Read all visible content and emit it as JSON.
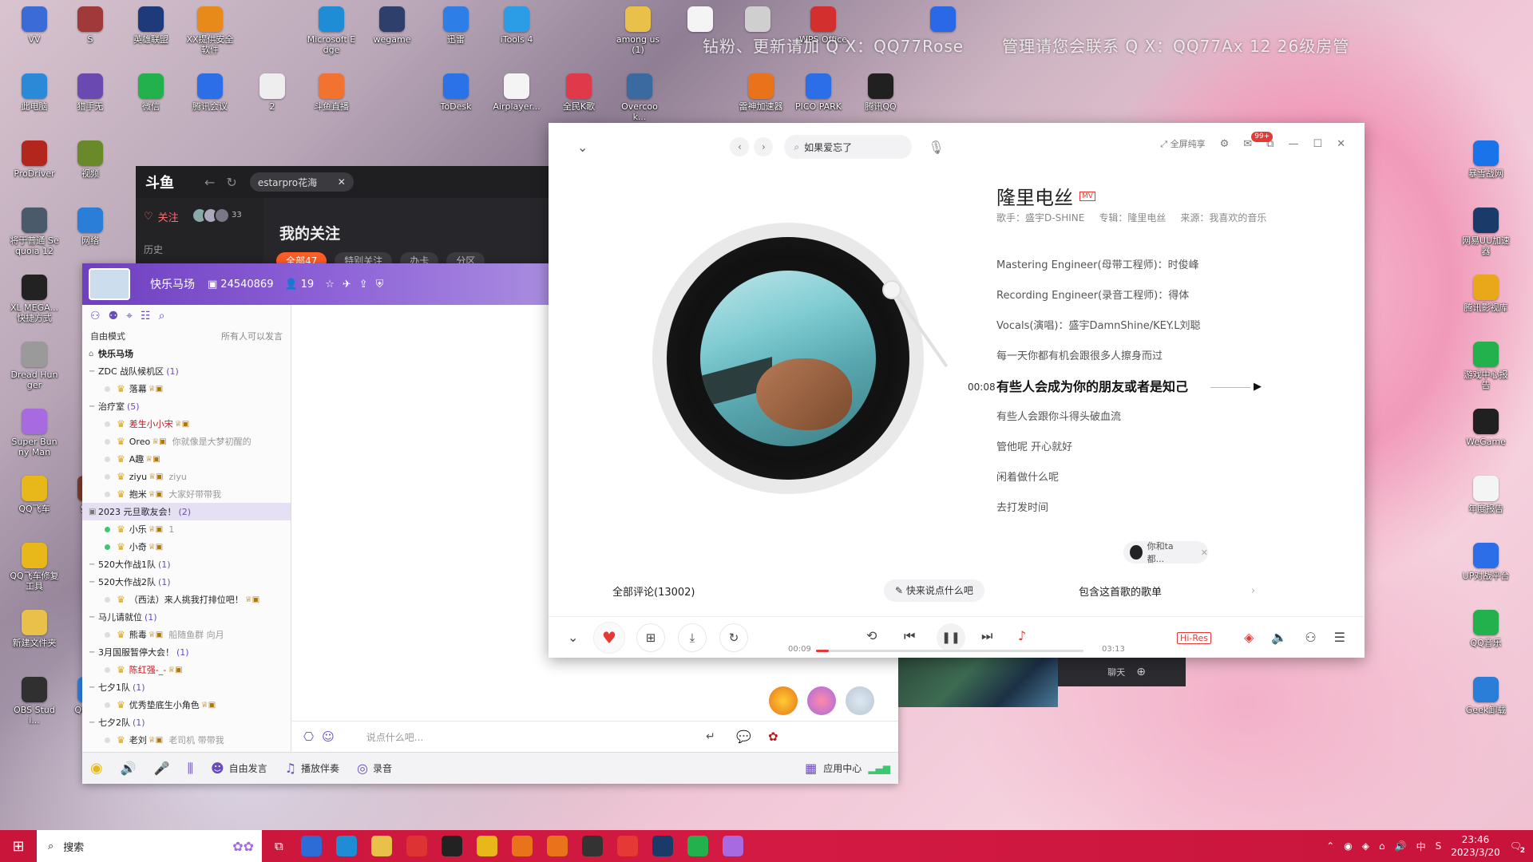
{
  "desktop": {
    "overlay_lines": [
      "钻粉、更新请加 Q X：QQ77Rose",
      "管理请您会联系 Q X：QQ77Ax   12 26级房管"
    ],
    "icons": [
      {
        "label": "VV",
        "color": "#3b6bd6"
      },
      {
        "label": "S",
        "color": "#a03a3a"
      },
      {
        "label": "英雄联盟",
        "color": "#1f3a7a"
      },
      {
        "label": "XX提供安全软件",
        "color": "#e88a1a"
      },
      {
        "label": "Microsoft Edge",
        "color": "#1f8cd6"
      },
      {
        "label": "wegame",
        "color": "#2d3f6a"
      },
      {
        "label": "迅雷",
        "color": "#2d7ee6"
      },
      {
        "label": "iTools 4",
        "color": "#2a9de6"
      },
      {
        "label": "among us(1)",
        "color": "#e8c04a"
      },
      {
        "label": "",
        "color": "#f4f4f4"
      },
      {
        "label": "",
        "color": "#cfcfcf"
      },
      {
        "label": "WPS Office",
        "color": "#d32f2f"
      },
      {
        "label": "",
        "color": "#2b68e8"
      },
      {
        "label": "此电脑",
        "color": "#2b8ad8"
      },
      {
        "label": "猎手无",
        "color": "#6a4ab0"
      },
      {
        "label": "微信",
        "color": "#23b14d"
      },
      {
        "label": "腾讯会议",
        "color": "#2b6ee8"
      },
      {
        "label": "2",
        "color": "#eeeeee"
      },
      {
        "label": "斗鱼直播",
        "color": "#f27330"
      },
      {
        "label": "ToDesk",
        "color": "#2a72e8"
      },
      {
        "label": "Airplayer...",
        "color": "#f4f4f4"
      },
      {
        "label": "全民K歌",
        "color": "#e03a4a"
      },
      {
        "label": "Overcook...",
        "color": "#3a6aa0"
      },
      {
        "label": "雷神加速器",
        "color": "#e8731a"
      },
      {
        "label": "PICO PARK",
        "color": "#2b6ee8"
      },
      {
        "label": "腾讯QQ",
        "color": "#202020"
      },
      {
        "label": "ProDriver",
        "color": "#b3261e"
      },
      {
        "label": "视频",
        "color": "#6a8a2a"
      },
      {
        "label": "将于普通 Sequoia 12",
        "color": "#4a5a6a"
      },
      {
        "label": "网络",
        "color": "#2b7ed8"
      },
      {
        "label": "XL MEGA...快捷方式",
        "color": "#222222"
      },
      {
        "label": "Dread Hunger",
        "color": "#9a9a9a"
      },
      {
        "label": "Super Bunny Man",
        "color": "#a76ae0"
      },
      {
        "label": "QQ飞车",
        "color": "#e8b81a"
      },
      {
        "label": "Som",
        "color": "#7a3a2a"
      },
      {
        "label": "QQ飞车修复工具",
        "color": "#e8b81a"
      },
      {
        "label": "新建文件夹",
        "color": "#e8c04a"
      },
      {
        "label": "OBS Studi...",
        "color": "#303030"
      },
      {
        "label": "QQ浏览",
        "color": "#2b7ee8"
      },
      {
        "label": "暴雪战网",
        "color": "#1a73e8"
      },
      {
        "label": "网易UU加速器",
        "color": "#1a3a6a"
      },
      {
        "label": "腾讯影视库",
        "color": "#e8a81a"
      },
      {
        "label": "游戏中心报告",
        "color": "#23b14d"
      },
      {
        "label": "WeGame",
        "color": "#202020"
      },
      {
        "label": "年度报告",
        "color": "#f4f4f4"
      },
      {
        "label": "UP对战平台",
        "color": "#2b6ee8"
      },
      {
        "label": "QQ音乐",
        "color": "#23b14d"
      },
      {
        "label": "Geek卸载",
        "color": "#2b7ed8"
      }
    ]
  },
  "douyu": {
    "logo": "斗鱼",
    "search_text": "estarpro花海",
    "follow_label": "关注",
    "avatar_count": "33",
    "history_label": "历史",
    "page_title": "我的关注",
    "tabs": [
      "全部47",
      "特别关注",
      "办卡",
      "分区"
    ]
  },
  "yy": {
    "channel_name": "快乐马场",
    "channel_id": "24540869",
    "user_count": "19",
    "mode_label": "自由模式",
    "mode_hint": "所有人可以发言",
    "tree": [
      {
        "type": "root",
        "name": "快乐马场"
      },
      {
        "type": "group",
        "name": "ZDC 战队候机区",
        "count": "(1)"
      },
      {
        "type": "user",
        "name": "落幕",
        "online": false,
        "sig": ""
      },
      {
        "type": "group",
        "name": "治疗室",
        "count": "(5)"
      },
      {
        "type": "user",
        "name": "差生小小宋",
        "online": false,
        "sig": "",
        "red": true
      },
      {
        "type": "user",
        "name": "Oreo",
        "online": false,
        "sig": "你就像是大梦初醒的"
      },
      {
        "type": "user",
        "name": "A趣",
        "online": false,
        "sig": ""
      },
      {
        "type": "user",
        "name": "ziyu",
        "online": false,
        "sig": "ziyu"
      },
      {
        "type": "user",
        "name": "抱米",
        "online": false,
        "sig": "大家好带带我"
      },
      {
        "type": "group",
        "name": "2023 元旦歌友会！",
        "count": "(2)",
        "hl": true
      },
      {
        "type": "user",
        "name": "小乐",
        "online": true,
        "sig": "1"
      },
      {
        "type": "user",
        "name": "小奇",
        "online": true,
        "sig": ""
      },
      {
        "type": "group",
        "name": "520大作战1队",
        "count": "(1)"
      },
      {
        "type": "group",
        "name": "520大作战2队",
        "count": "(1)"
      },
      {
        "type": "user",
        "name": "（西法）来人挑我打排位吧！",
        "online": false,
        "sig": ""
      },
      {
        "type": "group",
        "name": "马儿请就位",
        "count": "(1)"
      },
      {
        "type": "user",
        "name": "熊毒",
        "online": false,
        "sig": "船随鱼群  向月"
      },
      {
        "type": "group",
        "name": "3月国服暂停大会！",
        "count": "(1)"
      },
      {
        "type": "user",
        "name": "陈红强-_-",
        "online": false,
        "sig": "",
        "red": true
      },
      {
        "type": "group",
        "name": "七夕1队",
        "count": "(1)"
      },
      {
        "type": "user",
        "name": "优秀垫底生小角色",
        "online": false,
        "sig": ""
      },
      {
        "type": "group",
        "name": "七夕2队",
        "count": "(1)"
      },
      {
        "type": "user",
        "name": "老刘",
        "online": false,
        "sig": "老司机 带带我"
      }
    ],
    "input_placeholder": "说点什么吧...",
    "bottom": {
      "free_talk": "自由发言",
      "accompany": "播放伴奏",
      "record": "录音",
      "app_center": "应用中心"
    }
  },
  "music": {
    "search_text": "如果爱忘了",
    "fullscreen_label": "全屏纯享",
    "mail_badge": "99+",
    "song_title": "隆里电丝",
    "mv_badge": "MV",
    "meta": {
      "singer": "歌手：盛宇D-SHINE",
      "album": "专辑：隆里电丝",
      "source": "来源：我喜欢的音乐"
    },
    "lyrics": [
      "Mastering Engineer(母带工程师)：时俊峰",
      "Recording Engineer(录音工程师)：得体",
      "Vocals(演唱)：盛宇DamnShine/KEY.L刘聪",
      "每一天你都有机会跟很多人擦身而过",
      "有些人会成为你的朋友或者是知己",
      "有些人会跟你斗得头破血流",
      "管他呢 开心就好",
      "闲着做什么呢",
      "去打发时间"
    ],
    "current_lyric_index": 4,
    "current_time_label": "00:08",
    "comments_label": "全部评论(13002)",
    "quick_comment": "快来说点什么吧",
    "playlists_label": "包含这首歌的歌单",
    "friend_label": "你和ta都...",
    "time_start": "00:09",
    "time_end": "03:13",
    "progress": 0.047,
    "hires_label": "Hi-Res"
  },
  "gamethumb": {
    "label": "聊天"
  },
  "taskbar": {
    "search_label": "搜索",
    "time": "23:46",
    "date": "2023/3/20",
    "ime": "中",
    "notif_count": "2",
    "app_colors": [
      "#2d6bd6",
      "#1f8cd6",
      "#e8c04a",
      "#d33",
      "#222",
      "#e8b81a",
      "#e8731a",
      "#e8731a",
      "#333",
      "#e53935",
      "#1a3a6a",
      "#23b14d",
      "#a76ae0"
    ]
  }
}
